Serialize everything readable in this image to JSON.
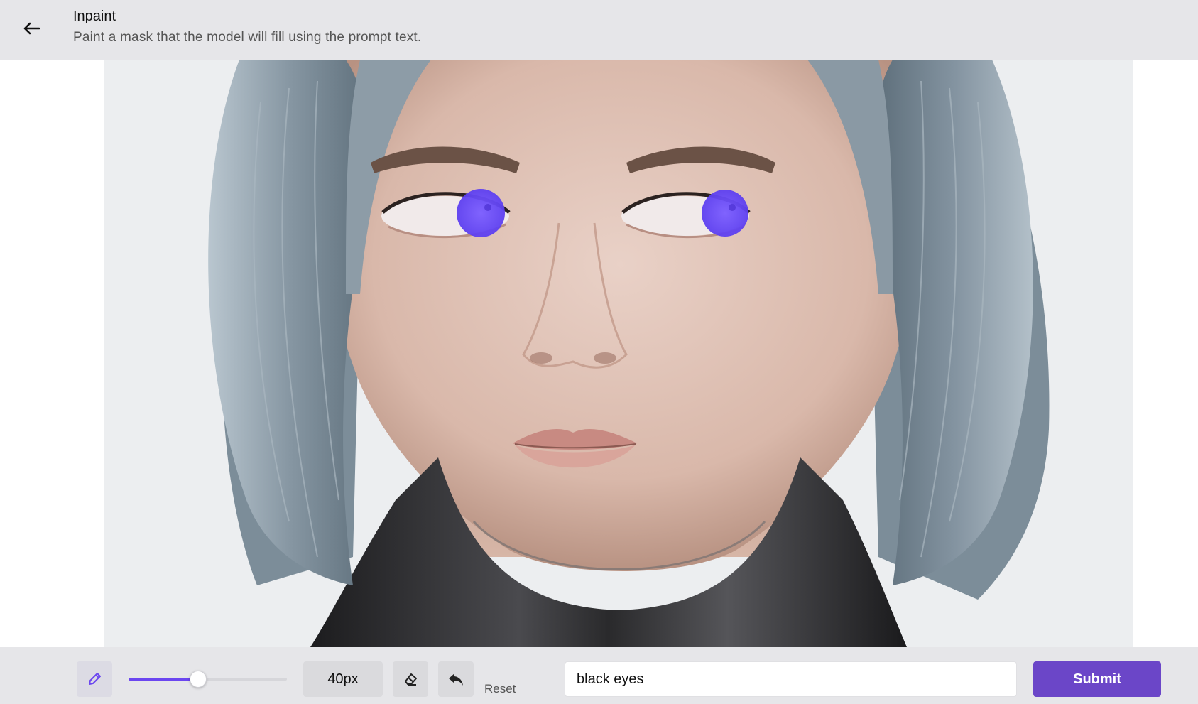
{
  "header": {
    "back_icon": "arrow-left-icon",
    "title": "Inpaint",
    "subtitle": "Paint a mask that the model will fill using the prompt text."
  },
  "canvas": {
    "image": "portrait-with-masked-eyes",
    "mask_color": "#6b4cf5"
  },
  "toolbar": {
    "brush_icon": "pencil-icon",
    "brush_size_fraction": 0.44,
    "brush_size_label": "40px",
    "eraser_icon": "eraser-icon",
    "undo_icon": "undo-icon",
    "reset_label": "Reset",
    "prompt_value": "black eyes",
    "submit_label": "Submit"
  },
  "colors": {
    "accent": "#6b46c8",
    "slider_fill": "#6b46f0",
    "header_bg": "#e6e6e9"
  }
}
